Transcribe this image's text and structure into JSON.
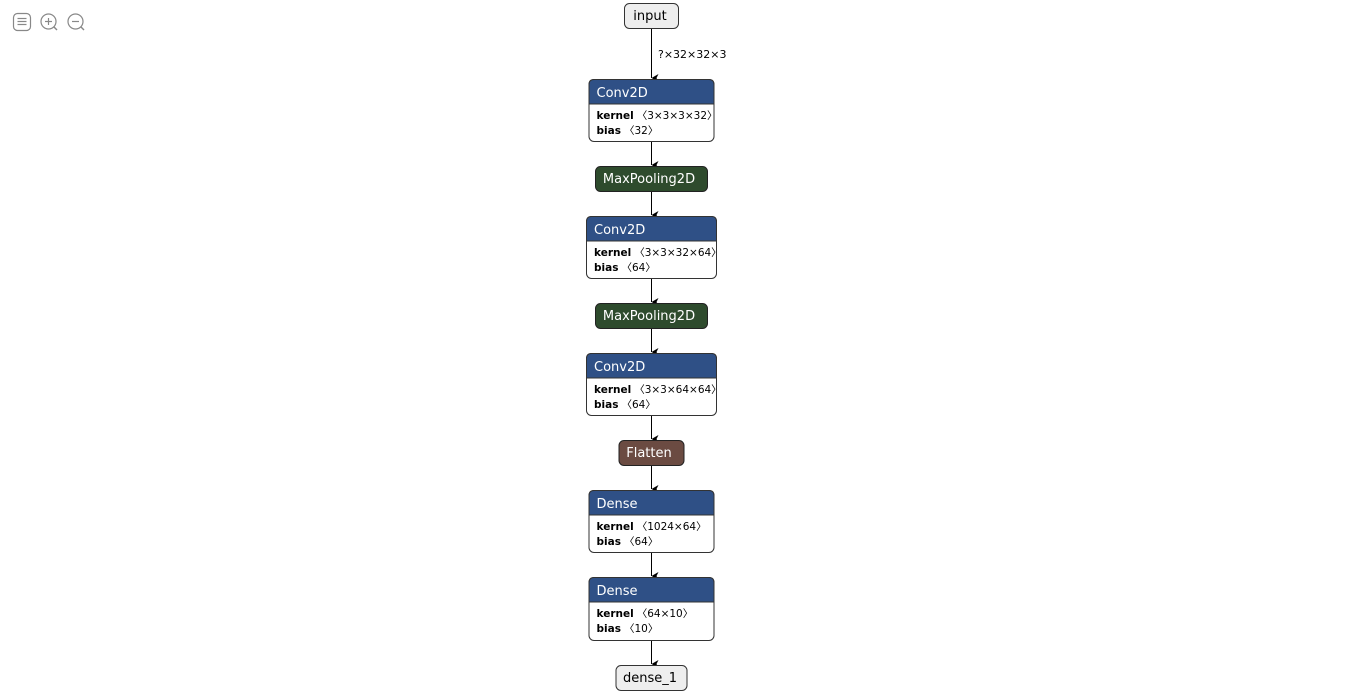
{
  "toolbar": {
    "buttons": [
      {
        "name": "sidebar-toggle-button",
        "icon": "menu-icon"
      },
      {
        "name": "zoom-in-button",
        "icon": "zoom-in-icon"
      },
      {
        "name": "zoom-out-button",
        "icon": "zoom-out-icon"
      }
    ]
  },
  "colors": {
    "layer": "#2f5086",
    "pool": "#2e4b2d",
    "reshape": "#6b4b42",
    "io_fill": "#eeeeee",
    "edge": "#000000"
  },
  "graph": {
    "nodes": [
      {
        "id": "input",
        "kind": "io",
        "title": "input"
      },
      {
        "id": "conv2d",
        "kind": "layer",
        "title": "Conv2D",
        "attrs": [
          {
            "name": "kernel",
            "value": "〈3×3×3×32〉"
          },
          {
            "name": "bias",
            "value": "〈32〉"
          }
        ]
      },
      {
        "id": "maxpool1",
        "kind": "pool",
        "title": "MaxPooling2D"
      },
      {
        "id": "conv2d_1",
        "kind": "layer",
        "title": "Conv2D",
        "attrs": [
          {
            "name": "kernel",
            "value": "〈3×3×32×64〉"
          },
          {
            "name": "bias",
            "value": "〈64〉"
          }
        ]
      },
      {
        "id": "maxpool2",
        "kind": "pool",
        "title": "MaxPooling2D"
      },
      {
        "id": "conv2d_2",
        "kind": "layer",
        "title": "Conv2D",
        "attrs": [
          {
            "name": "kernel",
            "value": "〈3×3×64×64〉"
          },
          {
            "name": "bias",
            "value": "〈64〉"
          }
        ]
      },
      {
        "id": "flatten",
        "kind": "reshape",
        "title": "Flatten"
      },
      {
        "id": "dense",
        "kind": "layer",
        "title": "Dense",
        "attrs": [
          {
            "name": "kernel",
            "value": "〈1024×64〉"
          },
          {
            "name": "bias",
            "value": "〈64〉"
          }
        ]
      },
      {
        "id": "dense_1",
        "kind": "layer",
        "title": "Dense",
        "attrs": [
          {
            "name": "kernel",
            "value": "〈64×10〉"
          },
          {
            "name": "bias",
            "value": "〈10〉"
          }
        ]
      },
      {
        "id": "output",
        "kind": "io",
        "title": "dense_1"
      }
    ],
    "edges": [
      {
        "from": "input",
        "to": "conv2d",
        "label": "?×32×32×3"
      },
      {
        "from": "conv2d",
        "to": "maxpool1",
        "label": ""
      },
      {
        "from": "maxpool1",
        "to": "conv2d_1",
        "label": ""
      },
      {
        "from": "conv2d_1",
        "to": "maxpool2",
        "label": ""
      },
      {
        "from": "maxpool2",
        "to": "conv2d_2",
        "label": ""
      },
      {
        "from": "conv2d_2",
        "to": "flatten",
        "label": ""
      },
      {
        "from": "flatten",
        "to": "dense",
        "label": ""
      },
      {
        "from": "dense",
        "to": "dense_1",
        "label": ""
      },
      {
        "from": "dense_1",
        "to": "output",
        "label": ""
      }
    ]
  }
}
